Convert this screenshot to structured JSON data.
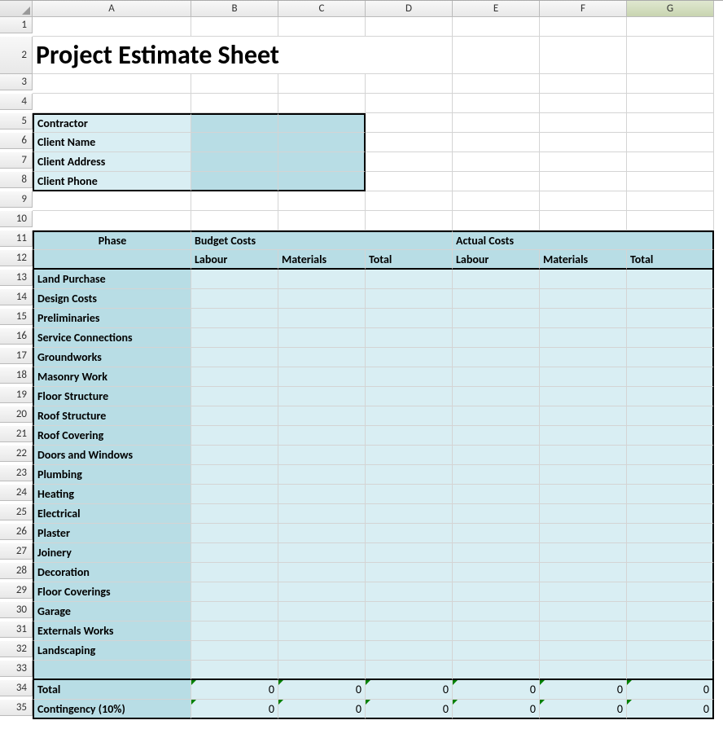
{
  "columns": [
    "A",
    "B",
    "C",
    "D",
    "E",
    "F",
    "G"
  ],
  "title": "Project Estimate Sheet",
  "info_labels": [
    "Contractor",
    "Client Name",
    "Client Address",
    "Client Phone"
  ],
  "header1": {
    "phase": "Phase",
    "budget": "Budget Costs",
    "actual": "Actual Costs"
  },
  "header2": {
    "labour": "Labour",
    "materials": "Materials",
    "total": "Total"
  },
  "phases": [
    "Land Purchase",
    "Design Costs",
    "Preliminaries",
    "Service Connections",
    "Groundworks",
    "Masonry Work",
    "Floor Structure",
    "Roof Structure",
    "Roof Covering",
    "Doors and Windows",
    "Plumbing",
    "Heating",
    "Electrical",
    "Plaster",
    "Joinery",
    "Decoration",
    "Floor Coverings",
    "Garage",
    "Externals Works",
    "Landscaping"
  ],
  "totals": {
    "label": "Total",
    "contingency_label": "Contingency (10%)",
    "budget_labour": "0",
    "budget_materials": "0",
    "budget_total": "0",
    "actual_labour": "0",
    "actual_materials": "0",
    "actual_total": "0",
    "c_budget_labour": "0",
    "c_budget_materials": "0",
    "c_budget_total": "0",
    "c_actual_labour": "0",
    "c_actual_materials": "0",
    "c_actual_total": "0"
  }
}
